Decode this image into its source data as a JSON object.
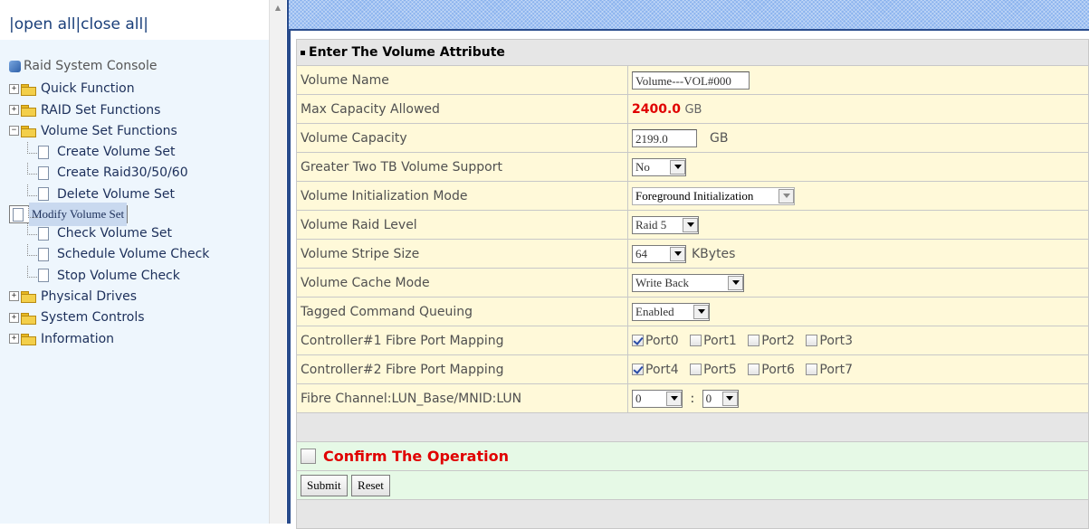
{
  "nav": {
    "open_all": "open all",
    "close_all": "close all",
    "root": "Raid System Console",
    "items": [
      {
        "label": "Quick Function",
        "expanded": false
      },
      {
        "label": "RAID Set Functions",
        "expanded": false
      },
      {
        "label": "Volume Set Functions",
        "expanded": true,
        "children": [
          "Create Volume Set",
          "Create Raid30/50/60",
          "Delete Volume Set",
          "Modify Volume Set",
          "Check Volume Set",
          "Schedule Volume Check",
          "Stop Volume Check"
        ],
        "selected": "Modify Volume Set"
      },
      {
        "label": "Physical Drives",
        "expanded": false
      },
      {
        "label": "System Controls",
        "expanded": false
      },
      {
        "label": "Information",
        "expanded": false
      }
    ]
  },
  "form": {
    "title": "Enter The Volume Attribute",
    "volume_name": {
      "label": "Volume Name",
      "value": "Volume---VOL#000"
    },
    "max_capacity": {
      "label": "Max Capacity Allowed",
      "value": "2400.0",
      "unit": "GB"
    },
    "volume_capacity": {
      "label": "Volume Capacity",
      "value": "2199.0",
      "unit": "GB"
    },
    "greater_two_tb": {
      "label": "Greater Two TB Volume Support",
      "value": "No"
    },
    "init_mode": {
      "label": "Volume Initialization Mode",
      "value": "Foreground Initialization"
    },
    "raid_level": {
      "label": "Volume Raid Level",
      "value": "Raid 5"
    },
    "stripe_size": {
      "label": "Volume Stripe Size",
      "value": "64",
      "unit": "KBytes"
    },
    "cache_mode": {
      "label": "Volume Cache Mode",
      "value": "Write Back"
    },
    "tcq": {
      "label": "Tagged Command Queuing",
      "value": "Enabled"
    },
    "ctrl1_mapping": {
      "label": "Controller#1 Fibre Port Mapping",
      "ports": [
        {
          "name": "Port0",
          "checked": true
        },
        {
          "name": "Port1",
          "checked": false
        },
        {
          "name": "Port2",
          "checked": false
        },
        {
          "name": "Port3",
          "checked": false
        }
      ]
    },
    "ctrl2_mapping": {
      "label": "Controller#2 Fibre Port Mapping",
      "ports": [
        {
          "name": "Port4",
          "checked": true
        },
        {
          "name": "Port5",
          "checked": false
        },
        {
          "name": "Port6",
          "checked": false
        },
        {
          "name": "Port7",
          "checked": false
        }
      ]
    },
    "lun": {
      "label": "Fibre Channel:LUN_Base/MNID:LUN",
      "base": "0",
      "separator": ":",
      "lun": "0"
    },
    "confirm": {
      "label": "Confirm The Operation",
      "checked": false
    },
    "submit": "Submit",
    "reset": "Reset"
  },
  "colors": {
    "accent_red": "#e00000",
    "row_bg": "#fff9d9",
    "confirm_bg": "#e6f9e6",
    "header_blue": "#8bb3ee"
  }
}
